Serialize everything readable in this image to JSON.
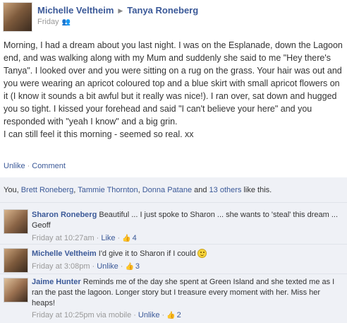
{
  "header": {
    "author": "Michelle Veltheim",
    "arrow_glyph": "▶",
    "recipient": "Tanya Roneberg",
    "timestamp": "Friday",
    "audience_icon": "friends-icon"
  },
  "post": {
    "lines": [
      "Morning, I had a dream about you last night. I was on the Esplanade, down the Lagoon end, and was walking along with my Mum and suddenly she said to me \"Hey there's Tanya\". I looked over and you were sitting on a rug on the grass. Your hair was out and you were wearing an apricot coloured top and a blue skirt with small apricot flowers on it (I know it sounds a bit awful but it really was nice!). I ran over, sat down and hugged you so tight. I kissed your forehead and said \"I can't believe your here\" and you responded with \"yeah I know\" and a big grin.",
      "I can still feel it this morning - seemed so real. xx"
    ]
  },
  "actions": {
    "unlike": "Unlike",
    "separator": "·",
    "comment": "Comment"
  },
  "likes": {
    "you": "You, ",
    "name1": "Brett Roneberg",
    "comma1": ", ",
    "name2": "Tammie Thornton",
    "comma2": ", ",
    "name3": "Donna Patane",
    "and": " and ",
    "others": "13 others",
    "suffix": " like this."
  },
  "comments": [
    {
      "name": "Sharon Roneberg",
      "text": " Beautiful ... I just spoke to Sharon ... she wants to 'steal' this dream ... Geoff",
      "time": "Friday at 10:27am",
      "action": "Like",
      "like_count": "4"
    },
    {
      "name": "Michelle Veltheim",
      "text": " I'd give it to Sharon if I could",
      "emoticon": "smiley-icon",
      "time": "Friday at 3:08pm",
      "action": "Unlike",
      "like_count": "3"
    },
    {
      "name": "Jaime Hunter",
      "text": " Reminds me of the day she spent at Green Island and she texted me as I ran the past the lagoon. Longer story but I treasure every moment with her. Miss her heaps!",
      "time": "Friday at 10:25pm via mobile",
      "action": "Unlike",
      "like_count": "2"
    }
  ],
  "colors": {
    "link": "#3b5998",
    "ufi_background": "#eff1f6",
    "meta_text": "#999999"
  }
}
